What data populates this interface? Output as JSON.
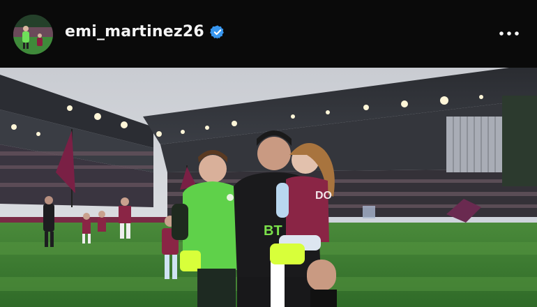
{
  "post": {
    "username": "emi_martinez26",
    "verified": true,
    "verified_color": "#3897f0",
    "more_icon": "more-horizontal-icon",
    "photo_description_colors": {
      "pitch": "#3d7a32",
      "claret": "#7a2a45",
      "keeper_kit": "#5fd14a"
    }
  },
  "photo_text": {
    "shirt_sponsor": "BT",
    "child_shirt_text": "DO"
  }
}
